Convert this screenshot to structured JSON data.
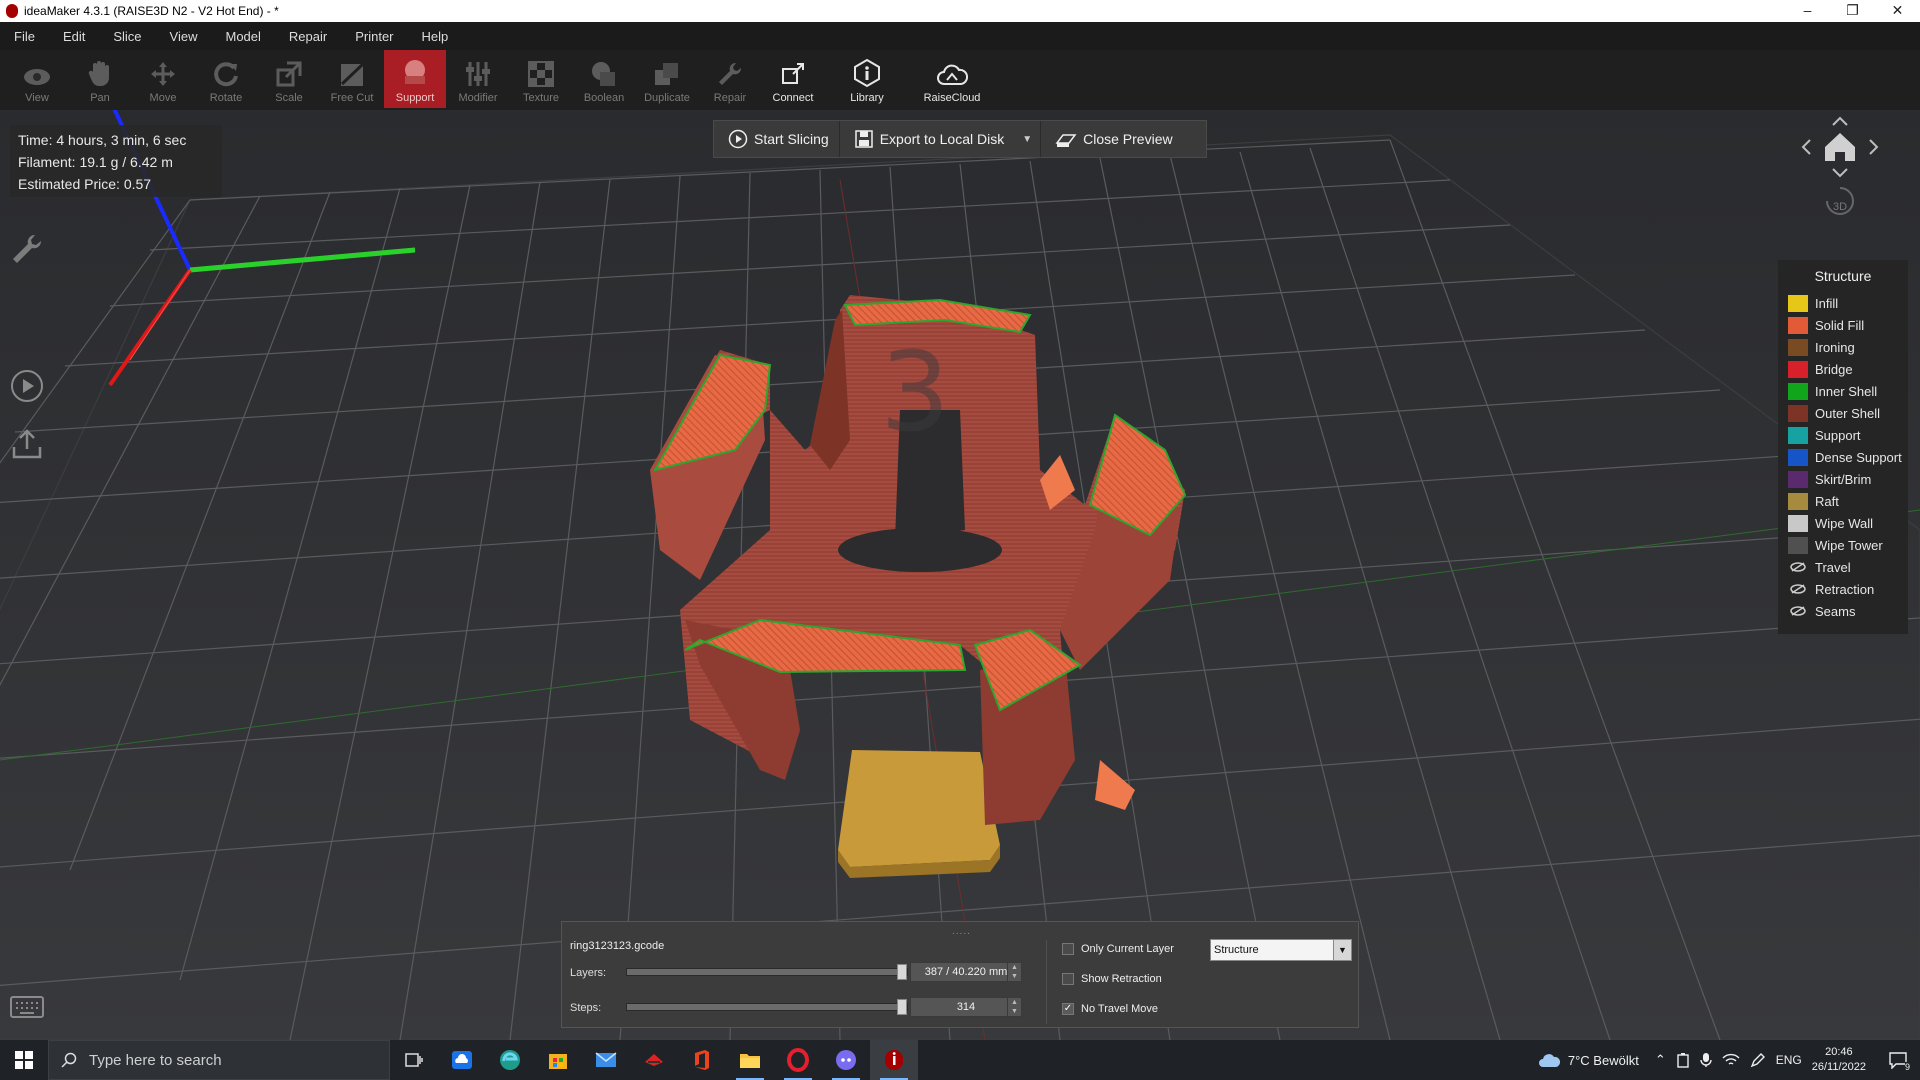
{
  "window": {
    "title": "ideaMaker 4.3.1 (RAISE3D N2 - V2 Hot End) - *"
  },
  "menu": [
    "File",
    "Edit",
    "Slice",
    "View",
    "Model",
    "Repair",
    "Printer",
    "Help"
  ],
  "toolbar": [
    {
      "label": "View",
      "icon": "eye-icon"
    },
    {
      "label": "Pan",
      "icon": "hand-icon"
    },
    {
      "label": "Move",
      "icon": "move-icon"
    },
    {
      "label": "Rotate",
      "icon": "rotate-icon"
    },
    {
      "label": "Scale",
      "icon": "scale-icon"
    },
    {
      "label": "Free Cut",
      "icon": "free-cut-icon"
    },
    {
      "label": "Support",
      "icon": "support-icon",
      "active": true
    },
    {
      "label": "Modifier",
      "icon": "modifier-icon"
    },
    {
      "label": "Texture",
      "icon": "texture-icon"
    },
    {
      "label": "Boolean",
      "icon": "boolean-icon"
    },
    {
      "label": "Duplicate",
      "icon": "duplicate-icon"
    },
    {
      "label": "Repair",
      "icon": "repair-icon"
    },
    {
      "label": "Connect",
      "icon": "connect-icon"
    },
    {
      "label": "Library",
      "icon": "library-icon"
    },
    {
      "label": "RaiseCloud",
      "icon": "cloud-icon"
    }
  ],
  "stats": {
    "time": "Time: 4 hours, 3 min, 6 sec",
    "filament": "Filament: 19.1 g / 6.42 m",
    "price": "Estimated Price: 0.57"
  },
  "slice_actions": {
    "start": "Start Slicing",
    "export": "Export to Local Disk",
    "close": "Close Preview"
  },
  "navcube": {
    "label": "3D"
  },
  "legend": {
    "title": "Structure",
    "items": [
      {
        "label": "Infill",
        "color": "#e6c619"
      },
      {
        "label": "Solid Fill",
        "color": "#e35b36"
      },
      {
        "label": "Ironing",
        "color": "#7a4a22"
      },
      {
        "label": "Bridge",
        "color": "#d8202a"
      },
      {
        "label": "Inner Shell",
        "color": "#11a51c"
      },
      {
        "label": "Outer Shell",
        "color": "#7d3326"
      },
      {
        "label": "Support",
        "color": "#17a2a2"
      },
      {
        "label": "Dense Support",
        "color": "#1555c7"
      },
      {
        "label": "Skirt/Brim",
        "color": "#5b2a6e"
      },
      {
        "label": "Raft",
        "color": "#a68a3e"
      },
      {
        "label": "Wipe Wall",
        "color": "#c8c8c8"
      },
      {
        "label": "Wipe Tower",
        "color": "#505050"
      }
    ],
    "toggles": [
      {
        "label": "Travel"
      },
      {
        "label": "Retraction"
      },
      {
        "label": "Seams"
      }
    ]
  },
  "preview": {
    "filename": "ring3123123.gcode",
    "layers_label": "Layers:",
    "layers_value": "387 / 40.220 mm",
    "layers_fraction": 0.98,
    "steps_label": "Steps:",
    "steps_value": "314",
    "steps_fraction": 0.98,
    "only_current_layer": {
      "label": "Only Current Layer",
      "checked": false
    },
    "show_retraction": {
      "label": "Show Retraction",
      "checked": false
    },
    "no_travel_move": {
      "label": "No Travel Move",
      "checked": true
    },
    "view_mode": "Structure"
  },
  "taskbar": {
    "search_placeholder": "Type here to search",
    "weather": "7°C  Bewölkt",
    "language": "ENG",
    "time": "20:46",
    "date": "26/11/2022",
    "notifications": "9"
  }
}
